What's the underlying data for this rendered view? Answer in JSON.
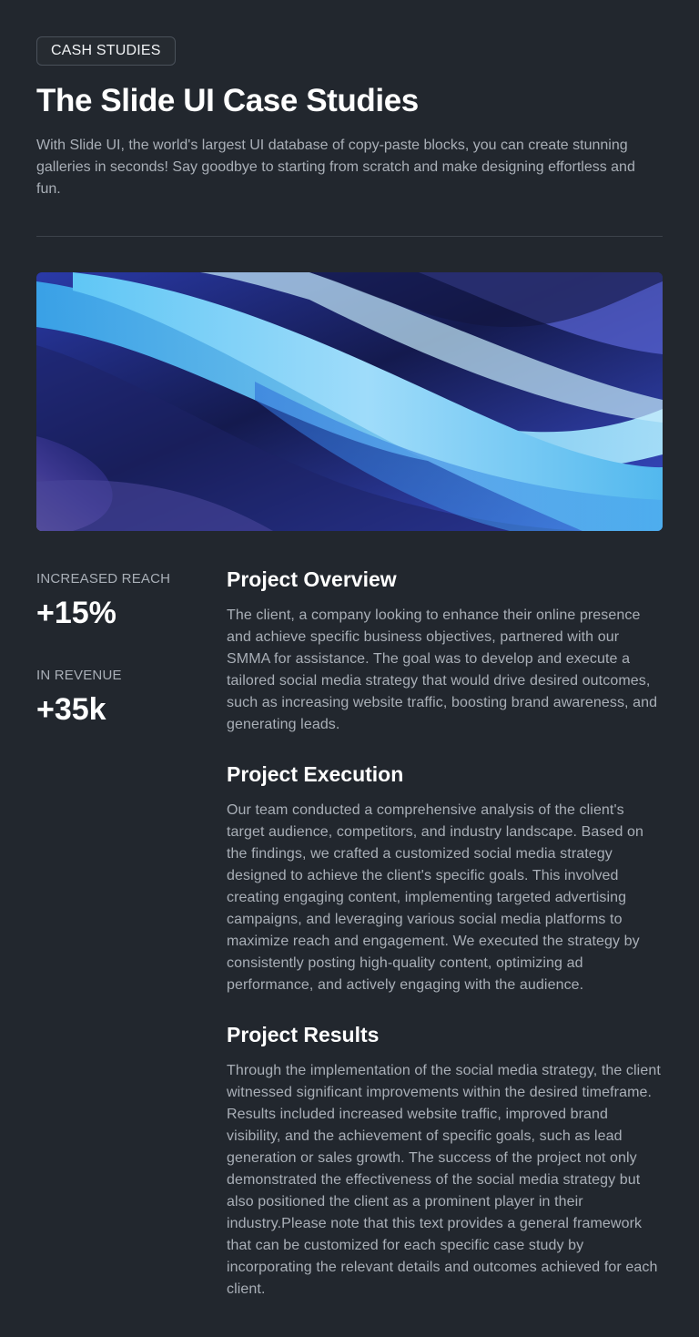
{
  "header": {
    "badge": "CASH STUDIES",
    "title": "The Slide UI Case Studies",
    "intro": "With Slide UI, the world's largest UI database of copy-paste blocks, you can create stunning galleries in seconds! Say goodbye to starting from scratch and make designing effortless and fun."
  },
  "hero": {
    "description_icon": "abstract-wave-image"
  },
  "stats": [
    {
      "label": "INCREASED REACH",
      "value": "+15%"
    },
    {
      "label": "IN REVENUE",
      "value": "+35k"
    }
  ],
  "sections": [
    {
      "title": "Project Overview",
      "body": "The client, a company looking to enhance their online presence and achieve specific business objectives, partnered with our SMMA for assistance. The goal was to develop and execute a tailored social media strategy that would drive desired outcomes, such as increasing website traffic, boosting brand awareness, and generating leads."
    },
    {
      "title": "Project Execution",
      "body": "Our team conducted a comprehensive analysis of the client's target audience, competitors, and industry landscape. Based on the findings, we crafted a customized social media strategy designed to achieve the client's specific goals. This involved creating engaging content, implementing targeted advertising campaigns, and leveraging various social media platforms to maximize reach and engagement. We executed the strategy by consistently posting high-quality content, optimizing ad performance, and actively engaging with the audience."
    },
    {
      "title": "Project Results",
      "body": "Through the implementation of the social media strategy, the client witnessed significant improvements within the desired timeframe. Results included increased website traffic, improved brand visibility, and the achievement of specific goals, such as lead generation or sales growth. The success of the project not only demonstrated the effectiveness of the social media strategy but also positioned the client as a prominent player in their industry.Please note that this text provides a general framework that can be customized for each specific case study by incorporating the relevant details and outcomes achieved for each client."
    }
  ]
}
